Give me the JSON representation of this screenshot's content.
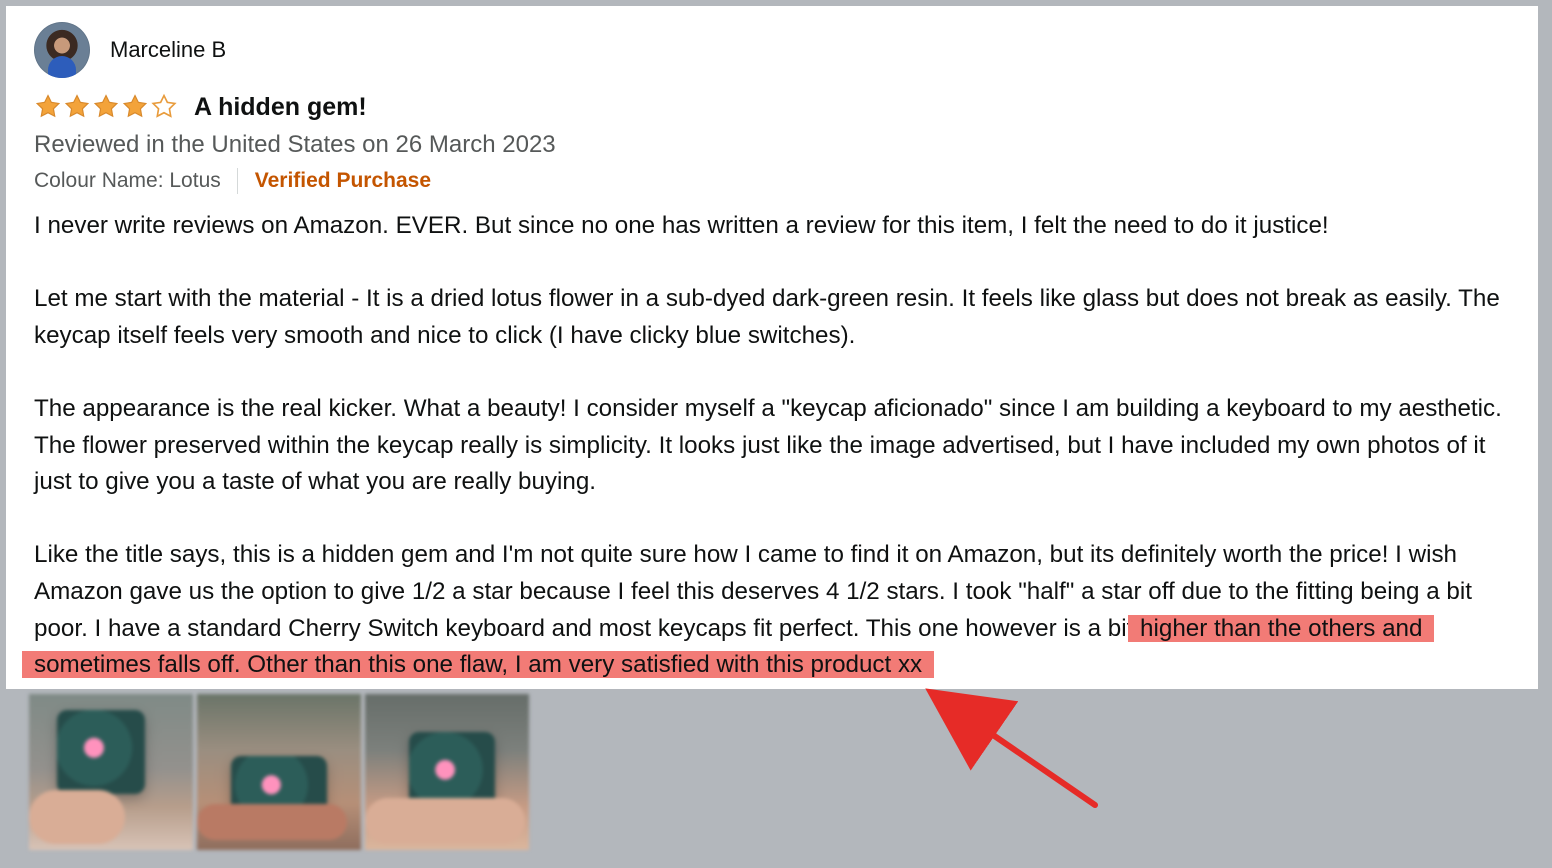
{
  "review": {
    "reviewer_name": "Marceline B",
    "rating": 4,
    "max_rating": 5,
    "title": "A hidden gem!",
    "date_text": "Reviewed in the United States on 26 March 2023",
    "colour": "Colour Name: Lotus",
    "verified": "Verified Purchase",
    "paragraphs": [
      "I never write reviews on Amazon. EVER. But since no one has written a review for this item, I felt the need to do it justice!",
      "Let me start with the material - It is a dried lotus flower in a sub-dyed dark-green resin. It feels like glass but does not break as easily. The keycap itself feels very smooth and nice to click (I have clicky blue switches).",
      "The appearance is the real kicker. What a beauty! I consider myself a \"keycap aficionado\" since I am building a keyboard to my aesthetic. The flower preserved within the keycap really is simplicity. It looks just like the image advertised, but I have included my own photos of it just to give you a taste of what you are really buying."
    ],
    "last_paragraph_before_highlight": "Like the title says, this is a hidden gem and I'm not quite sure how I came to find it on Amazon, but its definitely worth the price! I wish Amazon gave us the option to give 1/2 a star because I feel this deserves 4 1/2 stars. I took \"half\" a star off due to the fitting being a bit poor. I have a standard Cherry Switch keyboard and most keycaps fit perfect. This one however is a bit",
    "highlighted_text": "higher than the others and sometimes falls off. Other than this one flaw, I am very satisfied with this product xx"
  },
  "icons": {
    "avatar": "avatar-icon",
    "star": "star-icon",
    "arrow": "arrow-icon"
  },
  "colors": {
    "star_fill": "#f3a33a",
    "star_outline": "#e89b3b",
    "verified": "#c45500",
    "highlight": "#f27b76",
    "arrow": "#e62b27"
  }
}
